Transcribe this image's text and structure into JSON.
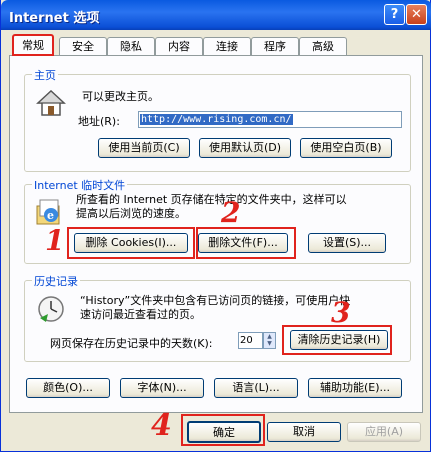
{
  "window": {
    "title": "Internet 选项",
    "help_glyph": "?",
    "close_glyph": "✕"
  },
  "tabs": [
    "常规",
    "安全",
    "隐私",
    "内容",
    "连接",
    "程序",
    "高级"
  ],
  "homepage": {
    "group_label": "主页",
    "description": "可以更改主页。",
    "address_label": "地址(R):",
    "address_value": "http://www.rising.com.cn/",
    "buttons": [
      "使用当前页(C)",
      "使用默认页(D)",
      "使用空白页(B)"
    ]
  },
  "temp_files": {
    "group_label": "Internet 临时文件",
    "description_line1": "所查看的 Internet 页存储在特定的文件夹中，这样可以",
    "description_line2": "提高以后浏览的速度。",
    "buttons": [
      "删除 Cookies(I)...",
      "删除文件(F)...",
      "设置(S)..."
    ]
  },
  "history": {
    "group_label": "历史记录",
    "description_line1": "“History”文件夹中包含有已访问页的链接，可使用户快",
    "description_line2": "速访问最近查看过的页。",
    "days_label": "网页保存在历史记录中的天数(K):",
    "days_value": "20",
    "clear_button": "清除历史记录(H)"
  },
  "bottom_row": [
    "颜色(O)...",
    "字体(N)...",
    "语言(L)...",
    "辅助功能(E)..."
  ],
  "dialog_buttons": {
    "ok": "确定",
    "cancel": "取消",
    "apply": "应用(A)"
  },
  "annotations": [
    "1",
    "2",
    "3",
    "4"
  ],
  "colors": {
    "annotation_red": "#e0231d",
    "titlebar_blue": "#0a5ae0",
    "group_label_blue": "#0046d5"
  }
}
